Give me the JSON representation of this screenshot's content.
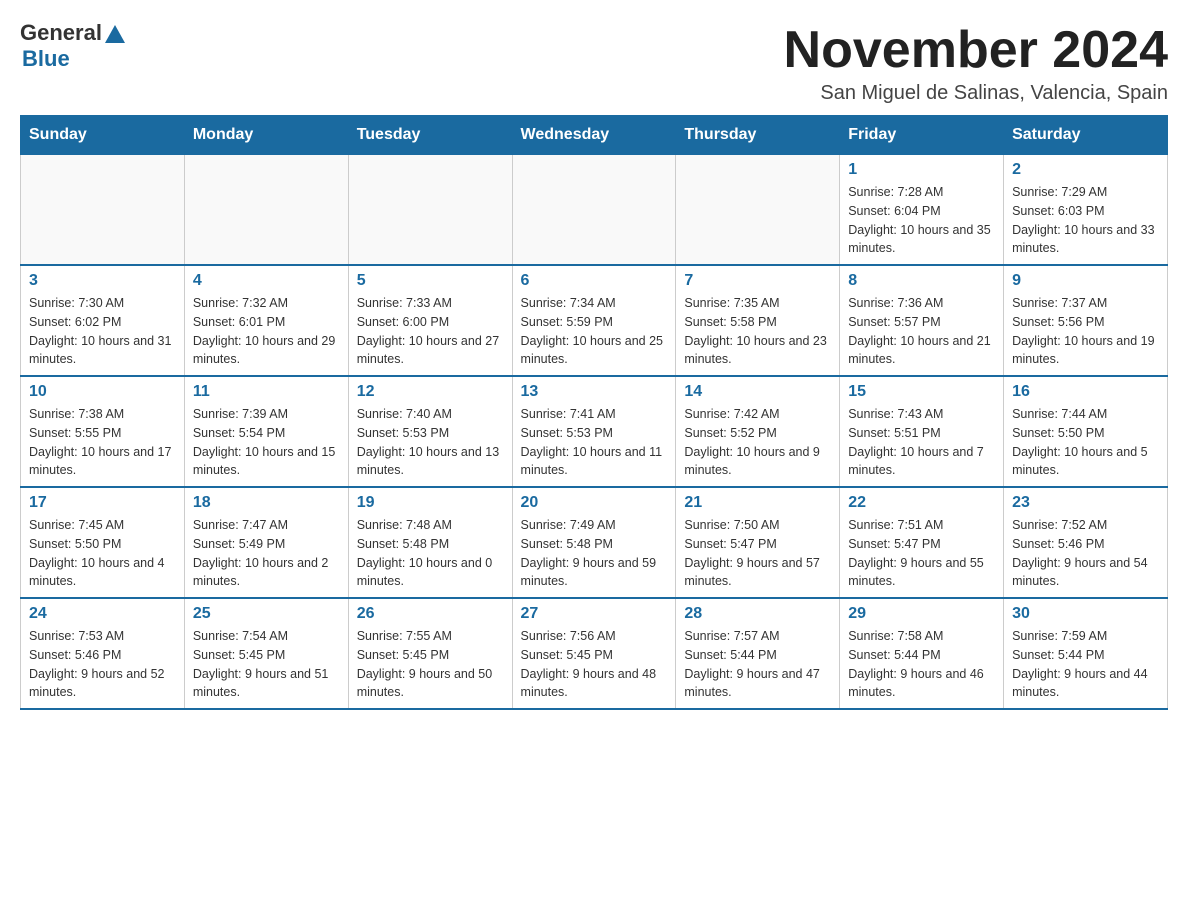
{
  "header": {
    "logo_general": "General",
    "logo_blue": "Blue",
    "month_title": "November 2024",
    "location": "San Miguel de Salinas, Valencia, Spain"
  },
  "weekdays": [
    "Sunday",
    "Monday",
    "Tuesday",
    "Wednesday",
    "Thursday",
    "Friday",
    "Saturday"
  ],
  "weeks": [
    [
      {
        "day": "",
        "info": ""
      },
      {
        "day": "",
        "info": ""
      },
      {
        "day": "",
        "info": ""
      },
      {
        "day": "",
        "info": ""
      },
      {
        "day": "",
        "info": ""
      },
      {
        "day": "1",
        "info": "Sunrise: 7:28 AM\nSunset: 6:04 PM\nDaylight: 10 hours and 35 minutes."
      },
      {
        "day": "2",
        "info": "Sunrise: 7:29 AM\nSunset: 6:03 PM\nDaylight: 10 hours and 33 minutes."
      }
    ],
    [
      {
        "day": "3",
        "info": "Sunrise: 7:30 AM\nSunset: 6:02 PM\nDaylight: 10 hours and 31 minutes."
      },
      {
        "day": "4",
        "info": "Sunrise: 7:32 AM\nSunset: 6:01 PM\nDaylight: 10 hours and 29 minutes."
      },
      {
        "day": "5",
        "info": "Sunrise: 7:33 AM\nSunset: 6:00 PM\nDaylight: 10 hours and 27 minutes."
      },
      {
        "day": "6",
        "info": "Sunrise: 7:34 AM\nSunset: 5:59 PM\nDaylight: 10 hours and 25 minutes."
      },
      {
        "day": "7",
        "info": "Sunrise: 7:35 AM\nSunset: 5:58 PM\nDaylight: 10 hours and 23 minutes."
      },
      {
        "day": "8",
        "info": "Sunrise: 7:36 AM\nSunset: 5:57 PM\nDaylight: 10 hours and 21 minutes."
      },
      {
        "day": "9",
        "info": "Sunrise: 7:37 AM\nSunset: 5:56 PM\nDaylight: 10 hours and 19 minutes."
      }
    ],
    [
      {
        "day": "10",
        "info": "Sunrise: 7:38 AM\nSunset: 5:55 PM\nDaylight: 10 hours and 17 minutes."
      },
      {
        "day": "11",
        "info": "Sunrise: 7:39 AM\nSunset: 5:54 PM\nDaylight: 10 hours and 15 minutes."
      },
      {
        "day": "12",
        "info": "Sunrise: 7:40 AM\nSunset: 5:53 PM\nDaylight: 10 hours and 13 minutes."
      },
      {
        "day": "13",
        "info": "Sunrise: 7:41 AM\nSunset: 5:53 PM\nDaylight: 10 hours and 11 minutes."
      },
      {
        "day": "14",
        "info": "Sunrise: 7:42 AM\nSunset: 5:52 PM\nDaylight: 10 hours and 9 minutes."
      },
      {
        "day": "15",
        "info": "Sunrise: 7:43 AM\nSunset: 5:51 PM\nDaylight: 10 hours and 7 minutes."
      },
      {
        "day": "16",
        "info": "Sunrise: 7:44 AM\nSunset: 5:50 PM\nDaylight: 10 hours and 5 minutes."
      }
    ],
    [
      {
        "day": "17",
        "info": "Sunrise: 7:45 AM\nSunset: 5:50 PM\nDaylight: 10 hours and 4 minutes."
      },
      {
        "day": "18",
        "info": "Sunrise: 7:47 AM\nSunset: 5:49 PM\nDaylight: 10 hours and 2 minutes."
      },
      {
        "day": "19",
        "info": "Sunrise: 7:48 AM\nSunset: 5:48 PM\nDaylight: 10 hours and 0 minutes."
      },
      {
        "day": "20",
        "info": "Sunrise: 7:49 AM\nSunset: 5:48 PM\nDaylight: 9 hours and 59 minutes."
      },
      {
        "day": "21",
        "info": "Sunrise: 7:50 AM\nSunset: 5:47 PM\nDaylight: 9 hours and 57 minutes."
      },
      {
        "day": "22",
        "info": "Sunrise: 7:51 AM\nSunset: 5:47 PM\nDaylight: 9 hours and 55 minutes."
      },
      {
        "day": "23",
        "info": "Sunrise: 7:52 AM\nSunset: 5:46 PM\nDaylight: 9 hours and 54 minutes."
      }
    ],
    [
      {
        "day": "24",
        "info": "Sunrise: 7:53 AM\nSunset: 5:46 PM\nDaylight: 9 hours and 52 minutes."
      },
      {
        "day": "25",
        "info": "Sunrise: 7:54 AM\nSunset: 5:45 PM\nDaylight: 9 hours and 51 minutes."
      },
      {
        "day": "26",
        "info": "Sunrise: 7:55 AM\nSunset: 5:45 PM\nDaylight: 9 hours and 50 minutes."
      },
      {
        "day": "27",
        "info": "Sunrise: 7:56 AM\nSunset: 5:45 PM\nDaylight: 9 hours and 48 minutes."
      },
      {
        "day": "28",
        "info": "Sunrise: 7:57 AM\nSunset: 5:44 PM\nDaylight: 9 hours and 47 minutes."
      },
      {
        "day": "29",
        "info": "Sunrise: 7:58 AM\nSunset: 5:44 PM\nDaylight: 9 hours and 46 minutes."
      },
      {
        "day": "30",
        "info": "Sunrise: 7:59 AM\nSunset: 5:44 PM\nDaylight: 9 hours and 44 minutes."
      }
    ]
  ]
}
